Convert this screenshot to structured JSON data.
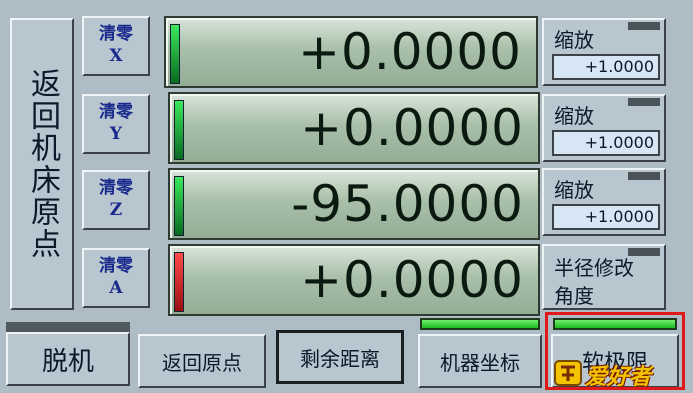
{
  "home_button_label": "返回机床原点",
  "axes": [
    {
      "zero_label": "清零",
      "axis": "X",
      "value": "+0.0000",
      "indicator_color": "#1fc23f"
    },
    {
      "zero_label": "清零",
      "axis": "Y",
      "value": "+0.0000",
      "indicator_color": "#1fc23f"
    },
    {
      "zero_label": "清零",
      "axis": "Z",
      "value": "-95.0000",
      "indicator_color": "#1fc23f"
    },
    {
      "zero_label": "清零",
      "axis": "A",
      "value": "+0.0000",
      "indicator_color": "#e12a2a"
    }
  ],
  "scale_panels": [
    {
      "label": "缩放",
      "value": "+1.0000"
    },
    {
      "label": "缩放",
      "value": "+1.0000"
    },
    {
      "label": "缩放",
      "value": "+1.0000"
    }
  ],
  "radius_panel": {
    "label1": "半径修改",
    "label2": "角度"
  },
  "bottom_buttons": {
    "offline": "脱机",
    "go_home": "返回原点",
    "remaining_distance": "剩余距离",
    "machine_coords": "机器坐标",
    "soft_limit": "软极限"
  },
  "watermark": "爱好者",
  "colors": {
    "panel": "#aebcc5",
    "dro_green": "#a9c0aa",
    "led_green": "#1fc23f",
    "led_red": "#e12a2a",
    "highlight": "#e01a1a"
  }
}
